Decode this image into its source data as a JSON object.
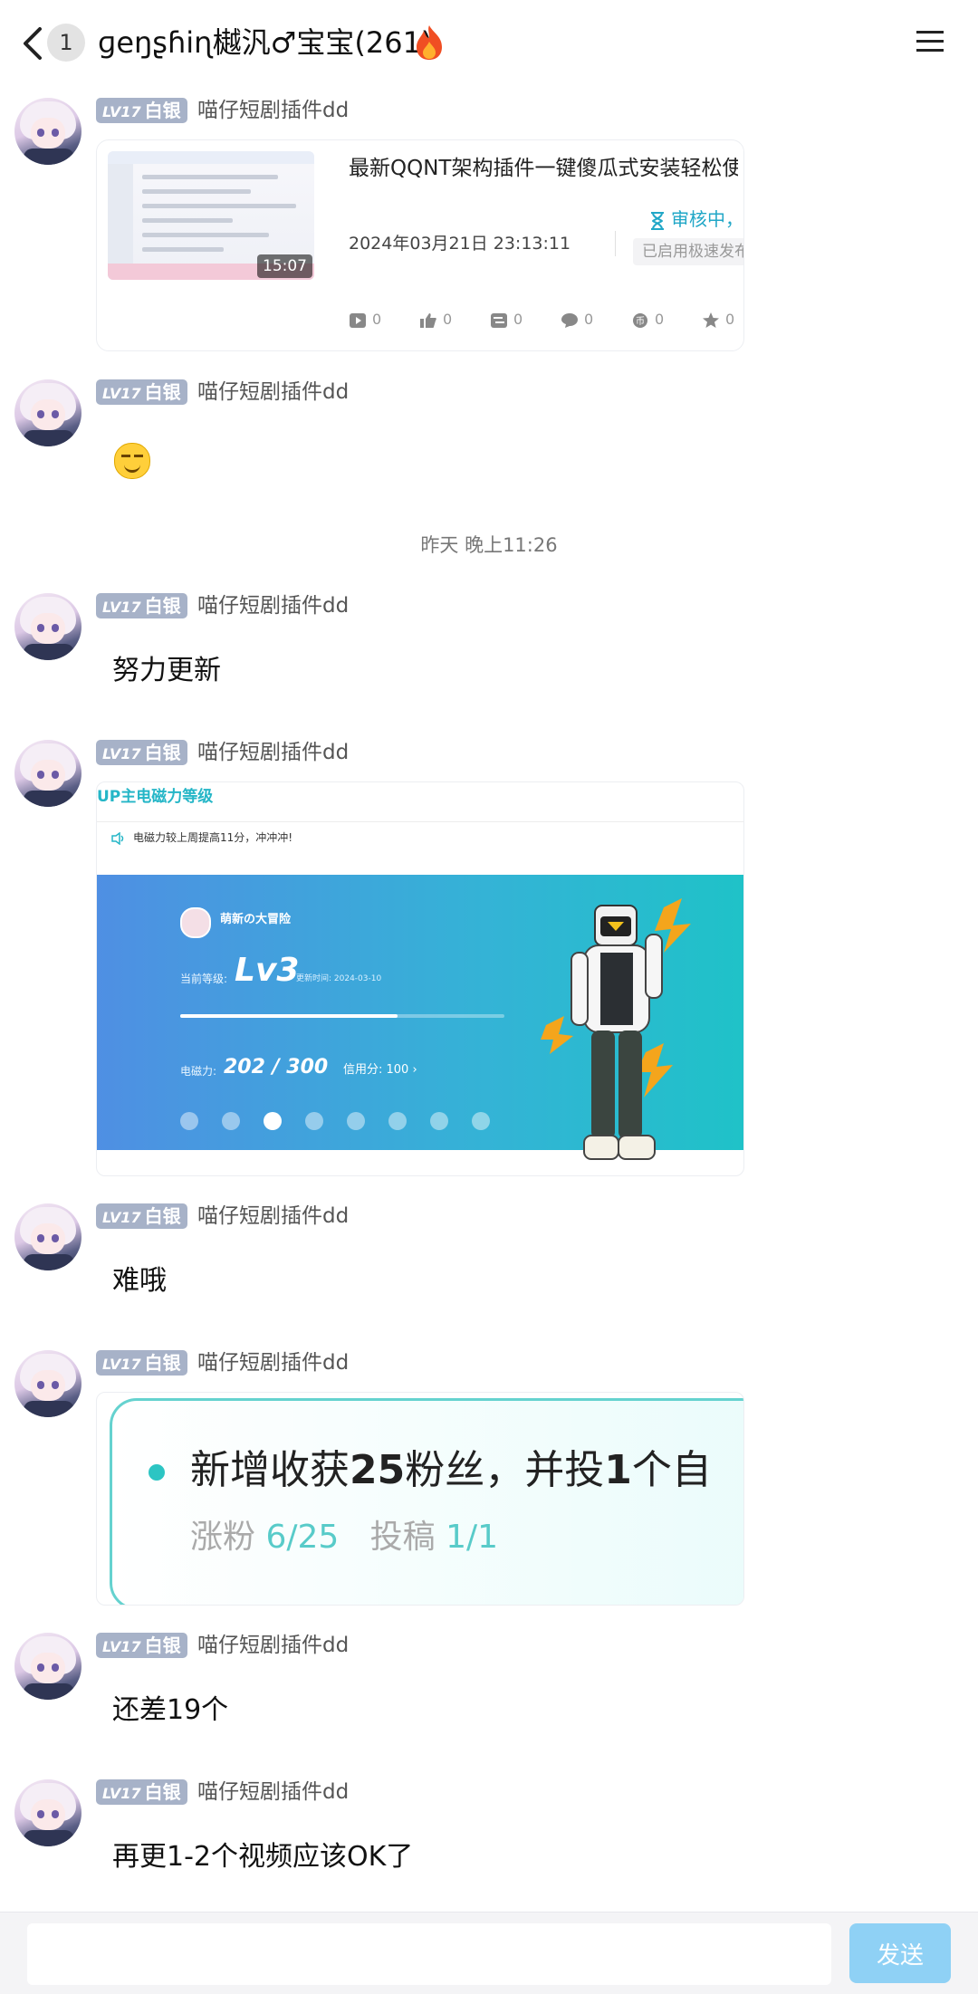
{
  "header": {
    "unread_count": "1",
    "title": "ɡeŋʂɦiɳ樾汎♂宝宝(261)"
  },
  "messages": [
    {
      "badge_level": "LV17",
      "badge_rank": "白银",
      "sender": "喵仔短剧插件dd",
      "type": "video_card",
      "card": {
        "duration": "15:07",
        "title": "最新QQNT架构插件一键傻瓜式安装轻松使",
        "time": "2024年03月21日 23:13:11",
        "status": "审核中，",
        "status_sub": "已启用极速发布",
        "stats": [
          "0",
          "0",
          "0",
          "0",
          "0",
          "0"
        ]
      }
    },
    {
      "badge_level": "LV17",
      "badge_rank": "白银",
      "sender": "喵仔短剧插件dd",
      "type": "emoji"
    },
    {
      "badge_level": "LV17",
      "badge_rank": "白银",
      "sender": "喵仔短剧插件dd",
      "type": "text",
      "text": "努力更新"
    },
    {
      "badge_level": "LV17",
      "badge_rank": "白银",
      "sender": "喵仔短剧插件dd",
      "type": "image_level",
      "image": {
        "head": "UP主电磁力等级",
        "sub": "电磁力较上周提高11分，冲冲冲!",
        "name": "萌新の大冒险",
        "level_label": "当前等级:",
        "level": "Lv3",
        "update_date": "更新时间: 2024-03-10",
        "progress": 0.67,
        "power_label": "电磁力:",
        "power": "202 / 300",
        "credit": "信用分: 100 ›"
      }
    },
    {
      "badge_level": "LV17",
      "badge_rank": "白银",
      "sender": "喵仔短剧插件dd",
      "type": "text",
      "text": "难哦"
    },
    {
      "badge_level": "LV17",
      "badge_rank": "白银",
      "sender": "喵仔短剧插件dd",
      "type": "image_fans",
      "image": {
        "line1_a": "新增收获",
        "line1_b": "25",
        "line1_c": "粉丝，并投",
        "line1_d": "1",
        "line1_e": "个自",
        "line2_a": "涨粉 ",
        "line2_b": "6/25",
        "line2_c": "   投稿 ",
        "line2_d": "1/1"
      }
    },
    {
      "badge_level": "LV17",
      "badge_rank": "白银",
      "sender": "喵仔短剧插件dd",
      "type": "text",
      "text": "还差19个"
    },
    {
      "badge_level": "LV17",
      "badge_rank": "白银",
      "sender": "喵仔短剧插件dd",
      "type": "text",
      "text": "再更1-2个视频应该OK了"
    }
  ],
  "timestamp": "昨天 晚上11:26",
  "composer": {
    "send_label": "发送",
    "placeholder": ""
  },
  "colors": {
    "badge": "#a7b2c8",
    "accent": "#21a7c7",
    "send": "#8fd1f5"
  }
}
